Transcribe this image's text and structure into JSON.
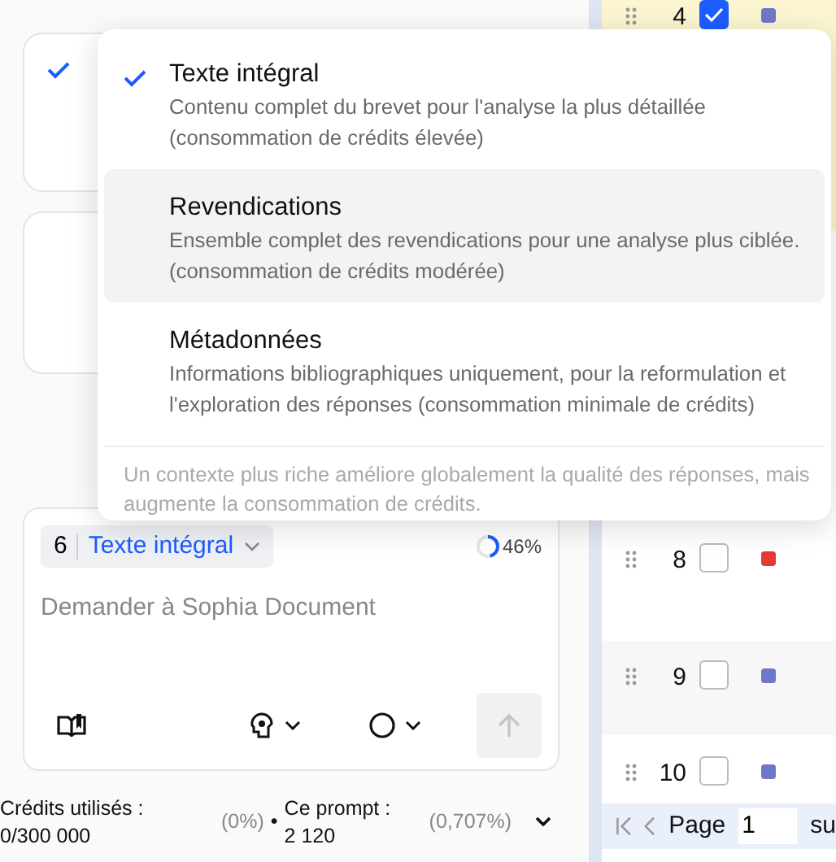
{
  "background_cards": [
    {
      "checked": true
    },
    {
      "checked": false
    }
  ],
  "context_menu": {
    "options": [
      {
        "title": "Texte intégral",
        "description": "Contenu complet du brevet pour l'analyse la plus détaillée (consommation de crédits élevée)",
        "selected": true,
        "hovered": false
      },
      {
        "title": "Revendications",
        "description": "Ensemble complet des revendications pour une analyse plus ciblée. (consommation de crédits modérée)",
        "selected": false,
        "hovered": true
      },
      {
        "title": "Métadonnées",
        "description": "Informations bibliographiques uniquement, pour la reformulation et l'exploration des réponses (consommation minimale de crédits)",
        "selected": false,
        "hovered": false
      }
    ],
    "note": "Un contexte plus riche améliore globalement la qualité des réponses, mais augmente la consommation de crédits."
  },
  "prompt": {
    "count": "6",
    "mode": "Texte intégral",
    "progress": {
      "level": 0.46,
      "reading": "46%"
    },
    "placeholder": "Demander à Sophia Document"
  },
  "credits": {
    "used_label": "Crédits utilisés :",
    "used_value": "0/300 000",
    "used_percent": "(0%)",
    "separator": "•",
    "prompt_label": "Ce prompt :",
    "prompt_value": "2 120",
    "prompt_percent": "(0,707%)"
  },
  "table": {
    "rows": [
      {
        "number": "4",
        "checked": true,
        "color": "#6e78c8",
        "highlighted": true
      },
      {
        "number": "8",
        "checked": false,
        "color": "#e53935",
        "highlighted": false
      },
      {
        "number": "9",
        "checked": false,
        "color": "#6e78c8",
        "highlighted": false
      },
      {
        "number": "10",
        "checked": false,
        "color": "#6e78c8",
        "highlighted": false
      }
    ],
    "pager": {
      "label": "Page",
      "value": "1",
      "trailing": "su"
    }
  }
}
